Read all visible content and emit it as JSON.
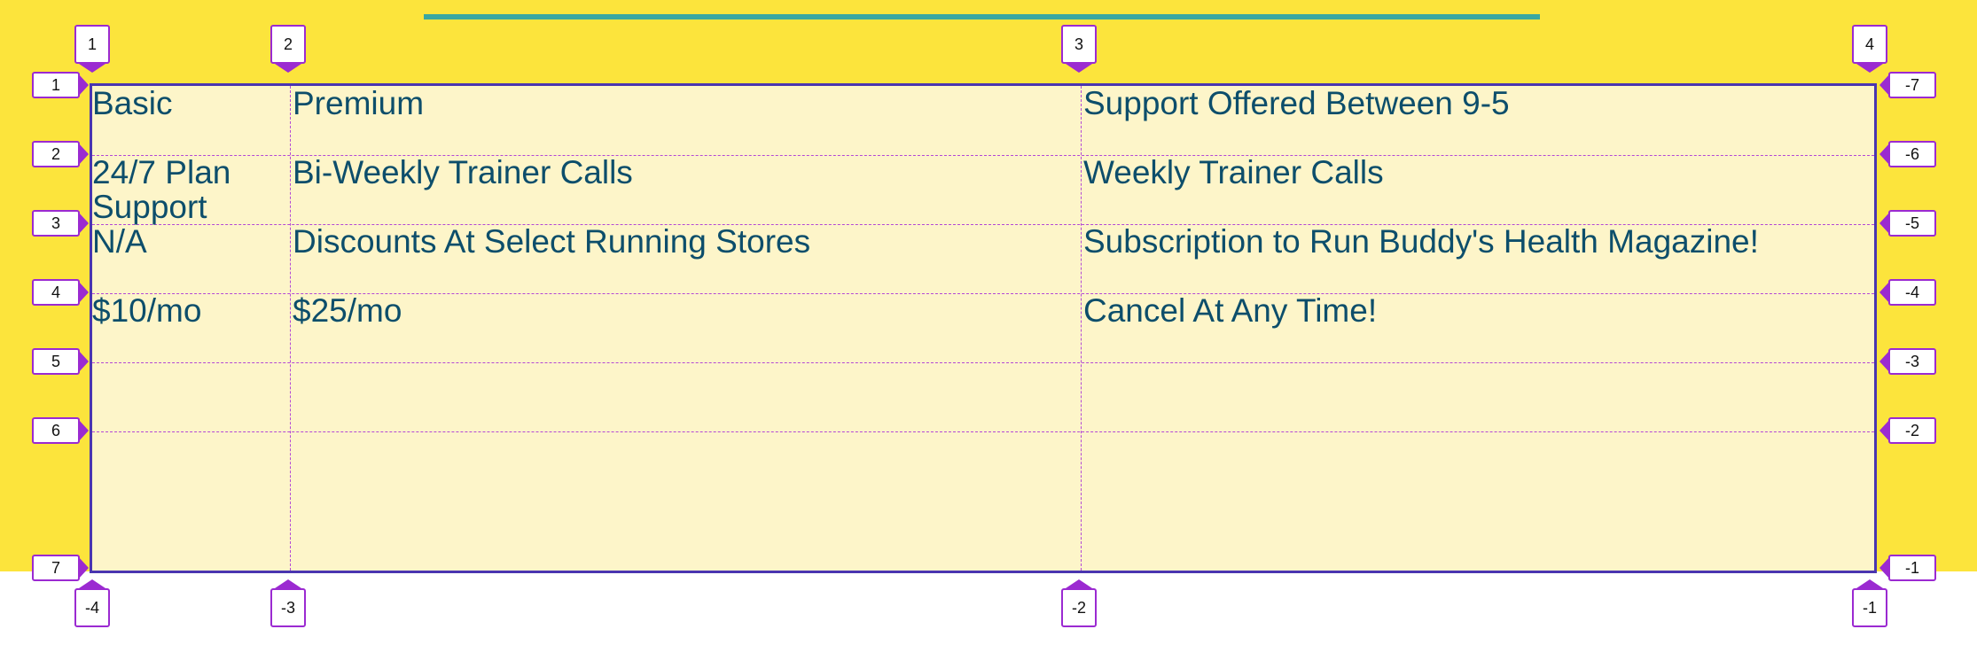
{
  "colors": {
    "page_background": "#fce43c",
    "accent_bar": "#3aa7a0",
    "grid_background": "#fdf5c9",
    "grid_border": "#4a35b0",
    "grid_lines": "#b347d6",
    "text": "#0d4e6b"
  },
  "table": {
    "rows": [
      [
        "Basic",
        "Premium",
        "Support Offered Between 9-5"
      ],
      [
        "24/7 Plan Support",
        "Bi-Weekly Trainer Calls",
        "Weekly Trainer Calls"
      ],
      [
        "N/A",
        "Discounts At Select Running Stores",
        "Subscription to Run Buddy's Health Magazine!"
      ],
      [
        "$10/mo",
        "$25/mo",
        "Cancel At Any Time!"
      ]
    ]
  },
  "grid_overlay": {
    "column_labels_top": [
      "1",
      "2",
      "3",
      "4"
    ],
    "column_labels_bottom": [
      "-4",
      "-3",
      "-2",
      "-1"
    ],
    "row_labels_left": [
      "1",
      "2",
      "3",
      "4",
      "5",
      "6",
      "7"
    ],
    "row_labels_right": [
      "-7",
      "-6",
      "-5",
      "-4",
      "-3",
      "-2",
      "-1"
    ]
  }
}
